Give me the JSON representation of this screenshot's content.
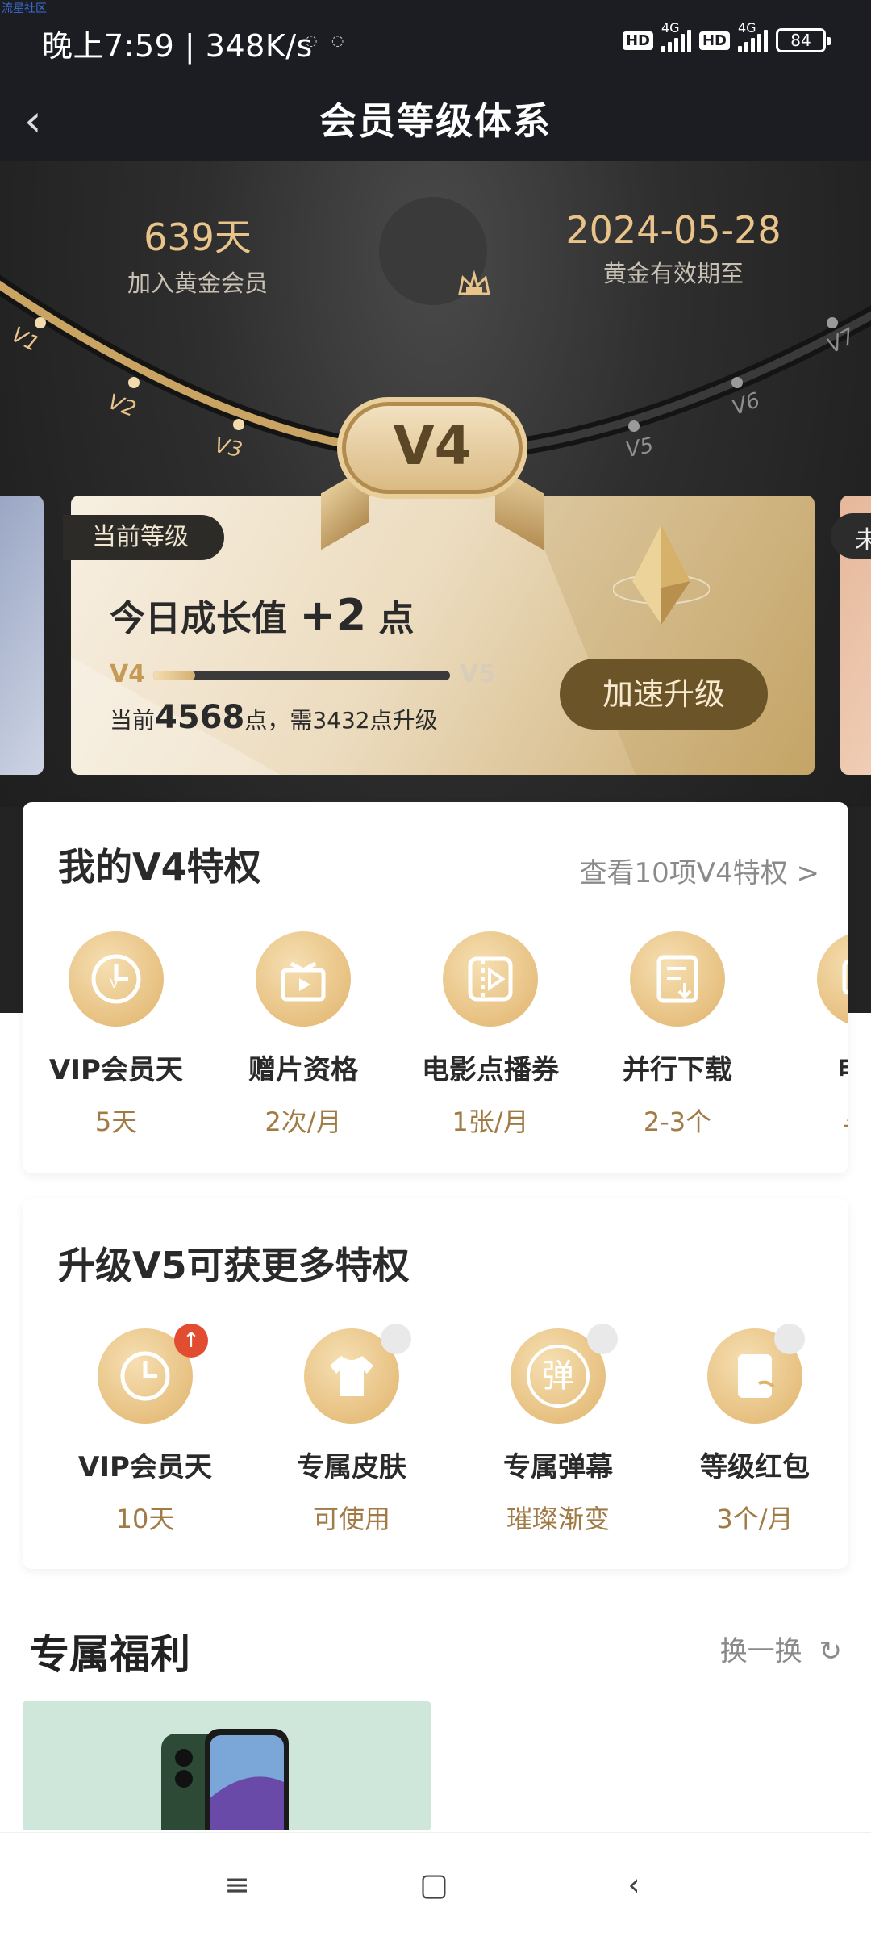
{
  "watermark": "流星社区",
  "statusbar": {
    "time": "晚上7:59 | 348K/s",
    "network": "4G",
    "battery": "84"
  },
  "nav": {
    "title": "会员等级体系"
  },
  "stats": {
    "days_value": "639天",
    "days_label": "加入黄金会员",
    "expiry_value": "2024-05-28",
    "expiry_label": "黄金有效期至"
  },
  "levels": [
    "V1",
    "V2",
    "V3",
    "V4",
    "V5",
    "V6",
    "V7"
  ],
  "current_level": "V4",
  "card": {
    "tag": "当前等级",
    "growth_prefix": "今日成长值",
    "growth_value": "+2",
    "growth_unit": "点",
    "progress_from": "V4",
    "progress_to": "V5",
    "progress_fraction": 0.14,
    "points_prefix": "当前",
    "points_value": "4568",
    "points_suffix": "点，需3432点升级",
    "boost_label": "加速升级",
    "next_card_tag": "未"
  },
  "my_privileges": {
    "title": "我的V4特权",
    "link": "查看10项V4特权 >",
    "items": [
      {
        "name": "VIP会员天",
        "value": "5天",
        "icon": "clock-icon"
      },
      {
        "name": "赠片资格",
        "value": "2次/月",
        "icon": "gift-icon"
      },
      {
        "name": "电影点播券",
        "value": "1张/月",
        "icon": "ticket-icon"
      },
      {
        "name": "并行下载",
        "value": "2-3个",
        "icon": "download-icon"
      },
      {
        "name": "电视",
        "value": "与V",
        "icon": "tv-icon"
      }
    ]
  },
  "upgrade_privileges": {
    "title": "升级V5可获更多特权",
    "items": [
      {
        "name": "VIP会员天",
        "value": "10天",
        "icon": "clock-icon",
        "badge": "up"
      },
      {
        "name": "专属皮肤",
        "value": "可使用",
        "icon": "shirt-icon",
        "badge": "lock"
      },
      {
        "name": "专属弹幕",
        "value": "璀璨渐变",
        "icon": "danmu-icon",
        "badge": "lock",
        "glyph": "弹"
      },
      {
        "name": "等级红包",
        "value": "3个/月",
        "icon": "redpacket-icon",
        "badge": "lock"
      }
    ]
  },
  "welfare": {
    "title": "专属福利",
    "refresh": "换一换"
  },
  "colors": {
    "gold": "#e9c48a",
    "brown": "#6b5528",
    "accent_text": "#a07b45"
  }
}
